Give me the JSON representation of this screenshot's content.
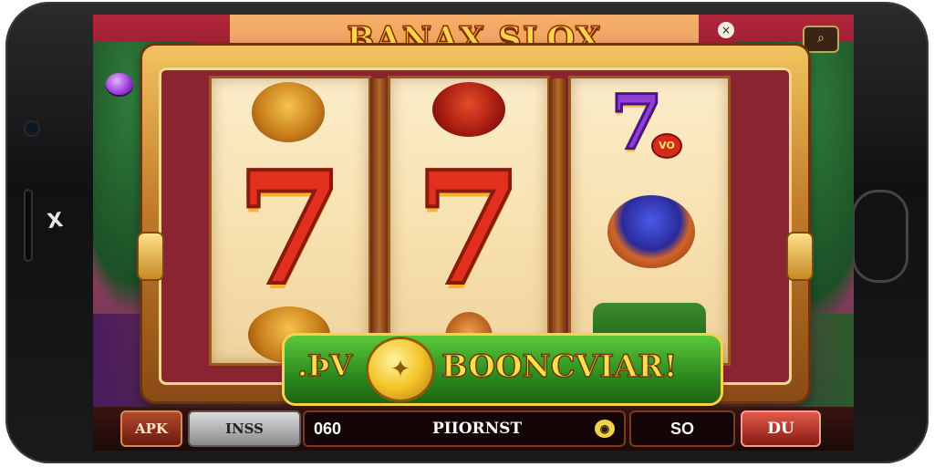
{
  "device": {
    "brand_mark": "X"
  },
  "game": {
    "title": "BANAX SLOX"
  },
  "reels": {
    "reel1": {
      "middle": "7"
    },
    "reel2": {
      "middle": "7"
    },
    "reel3": {
      "top": "7",
      "top_badge": "VO"
    }
  },
  "banner": {
    "left_text": ".ÞV",
    "right_text": "BOONCVIAR!"
  },
  "bottom_bar": {
    "apk_label": "APK",
    "grey_label": "INSS",
    "main_left": "060",
    "main_center": "PIIORNST",
    "number_label": "SO",
    "red_label": "DU"
  },
  "colors": {
    "title_gold": "#ffd64a",
    "seven_red": "#e3301e",
    "banner_green": "#2c8a1e",
    "frame_gold": "#c27d28"
  },
  "icons": [
    "search-icon",
    "close-icon",
    "coin-icon",
    "chip-icon"
  ]
}
